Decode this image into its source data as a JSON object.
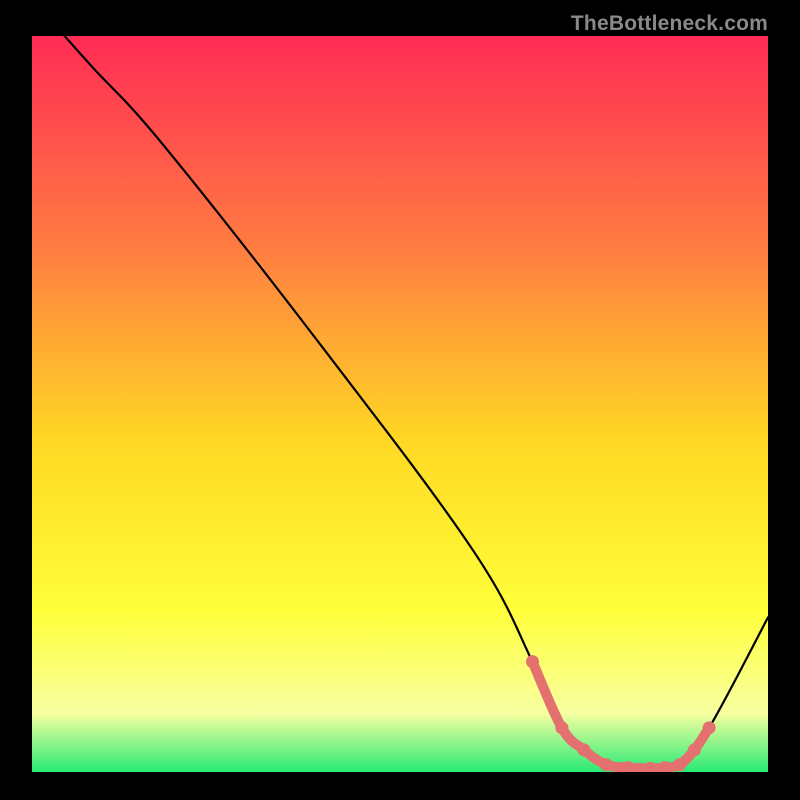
{
  "attribution": "TheBottleneck.com",
  "colors": {
    "bg": "#000000",
    "grad_top": "#ff2b55",
    "grad_upper_mid": "#ff7a42",
    "grad_mid": "#ffd824",
    "grad_lower_mid": "#ffff3a",
    "grad_low": "#f7ffa0",
    "grad_bottom": "#28ea76",
    "curve": "#000000",
    "highlight": "#e4716f"
  },
  "chart_data": {
    "type": "line",
    "title": "",
    "xlabel": "",
    "ylabel": "",
    "xlim": [
      0,
      100
    ],
    "ylim": [
      0,
      100
    ],
    "grid": false,
    "legend": false,
    "series": [
      {
        "name": "bottleneck-curve",
        "x": [
          0,
          8,
          18,
          40,
          60,
          68,
          72,
          78,
          84,
          88,
          92,
          100
        ],
        "values": [
          105,
          96,
          85,
          57,
          30,
          15,
          6,
          1,
          0.5,
          1,
          6,
          21
        ]
      },
      {
        "name": "optimal-highlight",
        "x": [
          68,
          72,
          75,
          78,
          81,
          84,
          86,
          88,
          90,
          92
        ],
        "values": [
          15,
          6,
          3,
          1,
          0.6,
          0.5,
          0.6,
          1,
          3,
          6
        ]
      }
    ],
    "annotations": []
  }
}
